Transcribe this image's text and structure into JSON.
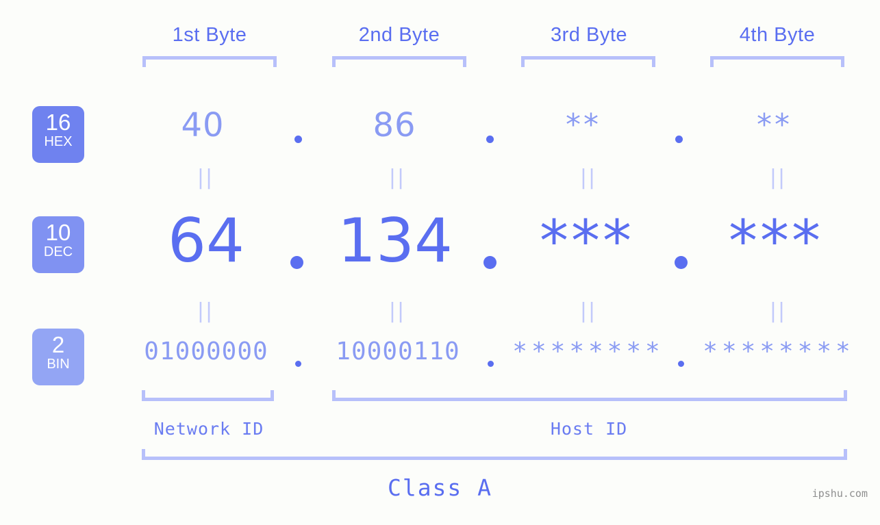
{
  "background_color": "#fcfdfa",
  "accent_strong": "#5a6ef0",
  "accent_light": "#8a9bf3",
  "accent_bracket": "#b7c0fa",
  "byte_headers": [
    {
      "label": "1st Byte"
    },
    {
      "label": "2nd Byte"
    },
    {
      "label": "3rd Byte"
    },
    {
      "label": "4th Byte"
    }
  ],
  "bases": [
    {
      "num": "16",
      "name": "HEX",
      "color": "#6f82ef"
    },
    {
      "num": "10",
      "name": "DEC",
      "color": "#8092f2"
    },
    {
      "num": "2",
      "name": "BIN",
      "color": "#93a5f4"
    }
  ],
  "rows": {
    "hex": {
      "base_num": "16",
      "base_name": "HEX",
      "values": [
        "40",
        "86",
        "**",
        "**"
      ]
    },
    "dec": {
      "base_num": "10",
      "base_name": "DEC",
      "values": [
        "64",
        "134",
        "***",
        "***"
      ]
    },
    "bin": {
      "base_num": "2",
      "base_name": "BIN",
      "values": [
        "01000000",
        "10000110",
        "********",
        "********"
      ]
    }
  },
  "separators": {
    "equals": "||",
    "dot": "."
  },
  "id_labels": {
    "network": "Network ID",
    "host": "Host ID"
  },
  "class_label": "Class A",
  "watermark": "ipshu.com"
}
